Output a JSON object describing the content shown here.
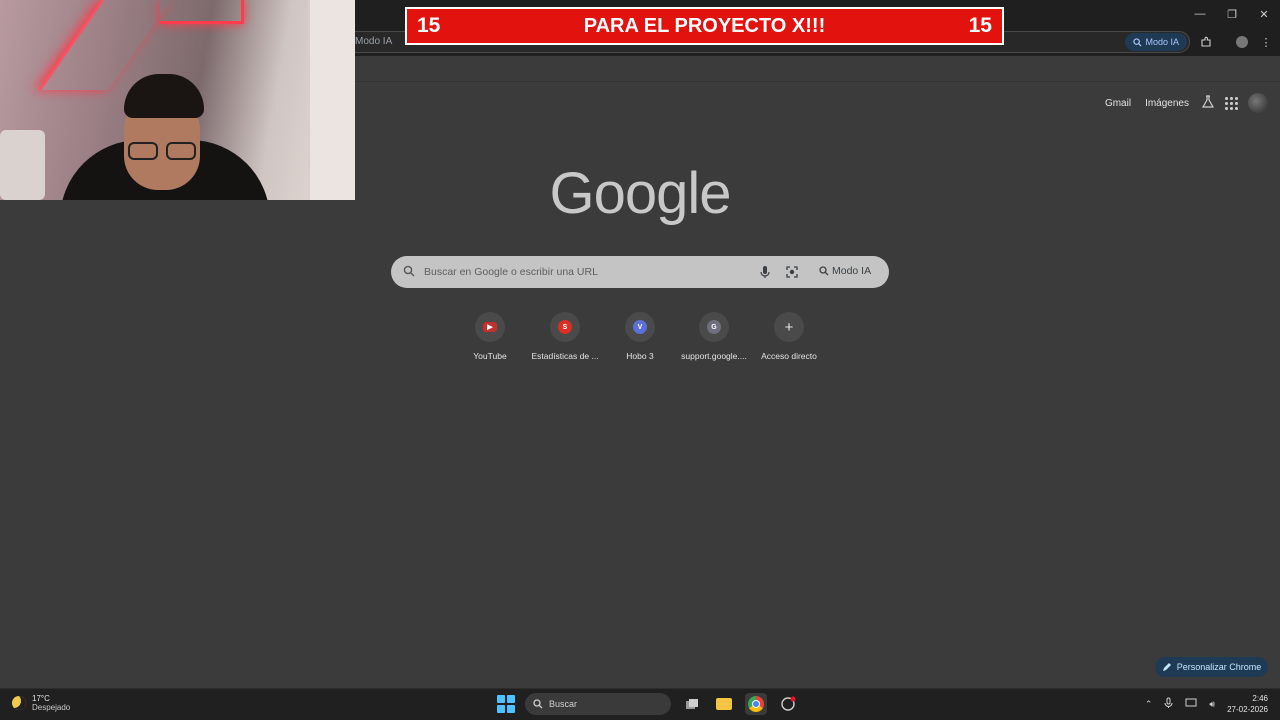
{
  "overlay": {
    "banner_left": "15",
    "banner_text": "PARA EL PROYECTO X!!!",
    "banner_right": "15",
    "banner_color": "#e2120f"
  },
  "browser": {
    "omnibox_text": "Modo IA",
    "omnibox_ai_label": "Modo IA",
    "icons": [
      "extensions-icon",
      "profile-icon",
      "menu-icon"
    ]
  },
  "ntp": {
    "header_links": [
      "Gmail",
      "Imágenes"
    ],
    "logo": "Google",
    "search_placeholder": "Buscar en Google o escribir una URL",
    "search_ai_label": "Modo IA",
    "shortcuts": [
      {
        "label": "YouTube",
        "badge": "▶",
        "color": "#c4302b"
      },
      {
        "label": "Estadísticas de ...",
        "badge": "S",
        "color": "#d93025"
      },
      {
        "label": "Hobo 3",
        "badge": "V",
        "color": "#5b6fd6"
      },
      {
        "label": "support.google....",
        "badge": "G",
        "color": "#6f6f7f"
      },
      {
        "label": "Acceso directo",
        "badge": "+",
        "color": "transparent"
      }
    ],
    "customize_label": "Personalizar Chrome"
  },
  "taskbar": {
    "weather_temp": "17°C",
    "weather_desc": "Despejado",
    "search_label": "Buscar",
    "time": "2:46",
    "date": "27-02-2026"
  }
}
